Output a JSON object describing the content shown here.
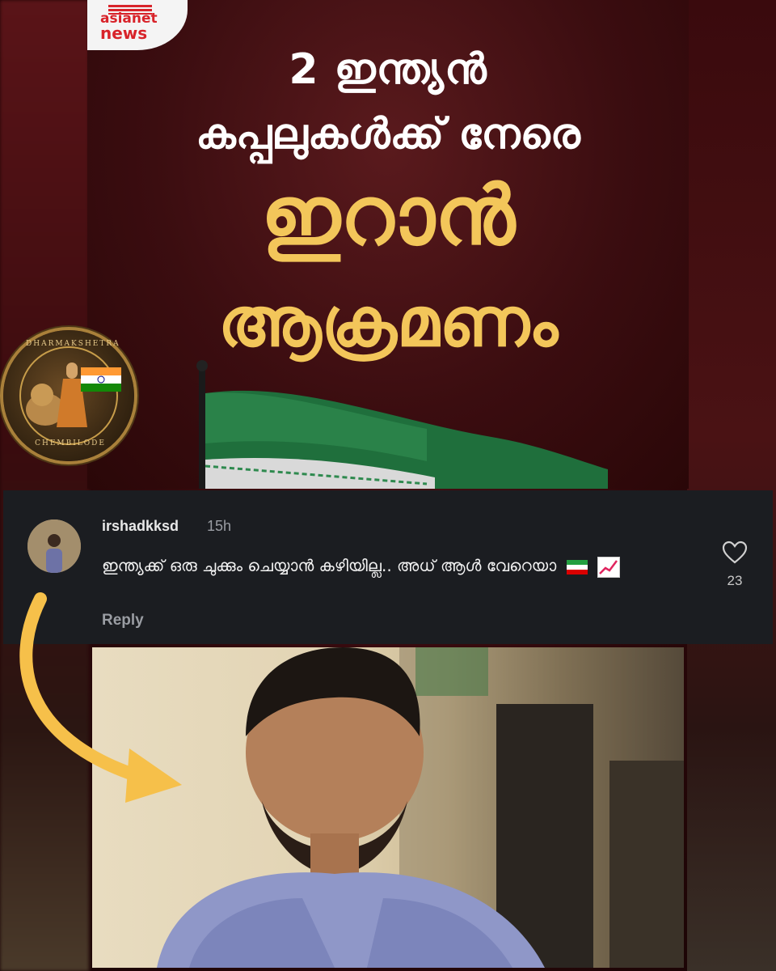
{
  "news_card": {
    "brand_top": "asianet",
    "brand_bottom": "news",
    "headline_line1": "2 ഇന്ത്യൻ",
    "headline_line2": "കപ്പലുകൾക്ക് നേരെ",
    "headline_line3": "ഇറാൻ",
    "headline_line4": "ആക്രമണം"
  },
  "emblem": {
    "top_text": "DHARMAKSHETRA",
    "bottom_text": "CHEMBILODE"
  },
  "comment": {
    "username": "irshadkksd",
    "time": "15h",
    "text": "ഇന്ത്യക്ക് ഒരു ചുക്കും ചെയ്യാൻ കഴിയില്ല.. അധ് ആൾ വേറെയാ",
    "reply_label": "Reply",
    "like_count": "23"
  },
  "colors": {
    "headline_accent": "#f3c65a",
    "panel_bg": "#1b1d21",
    "arrow": "#f6c04a"
  },
  "icons": {
    "like": "heart-icon",
    "flag_emoji": "iran-flag-icon",
    "chart_emoji": "chart-increasing-icon"
  }
}
